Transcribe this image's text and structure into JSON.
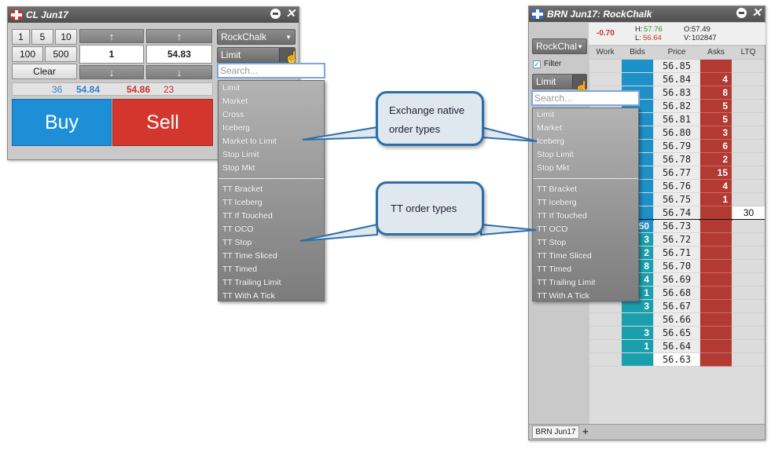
{
  "left_window": {
    "title": "CL Jun17",
    "qty_buttons": [
      "1",
      "5",
      "10",
      "100",
      "500"
    ],
    "clear_label": "Clear",
    "qty_value": "1",
    "price_value": "54.83",
    "account_dropdown": "RockChalk",
    "order_type_dropdown": "Limit",
    "market": {
      "bid_qty": "36",
      "bid_price": "54.84",
      "ask_price": "54.86",
      "ask_qty": "23"
    },
    "buy_label": "Buy",
    "sell_label": "Sell",
    "up_arrow": "↑",
    "down_arrow": "↓",
    "colors": {
      "buy": "#1e8fd6",
      "sell": "#d2362d",
      "bid_text": "#2a7fcf",
      "ask_text": "#c9302a"
    }
  },
  "left_menu": {
    "search_placeholder": "Search...",
    "exchange_items": [
      "Limit",
      "Market",
      "Cross",
      "Iceberg",
      "Market to Limit",
      "Stop Limit",
      "Stop Mkt"
    ],
    "tt_items": [
      "TT Bracket",
      "TT Iceberg",
      "TT If Touched",
      "TT OCO",
      "TT Stop",
      "TT Time Sliced",
      "TT Timed",
      "TT Trailing Limit",
      "TT With A Tick"
    ]
  },
  "callouts": {
    "exchange": "Exchange native order types",
    "tt": "TT order types"
  },
  "right_window": {
    "title": "BRN Jun17: RockChalk",
    "change": "-0.70",
    "high_label": "H:",
    "high": "57.76",
    "low_label": "L:",
    "low": "56.64",
    "open_label": "O:",
    "open": "57.49",
    "volume_label": "V:",
    "volume": "102847",
    "account_dropdown": "RockChal",
    "filter_label": "Filter",
    "order_type_dropdown": "Limit",
    "columns": [
      "Work",
      "Bids",
      "Price",
      "Asks",
      "LTQ"
    ],
    "tab_label": "BRN Jun17",
    "add_tab": "+",
    "ladder": [
      {
        "price": "56.85",
        "bid": "",
        "ask": ""
      },
      {
        "price": "56.84",
        "bid": "",
        "ask": "4"
      },
      {
        "price": "56.83",
        "bid": "",
        "ask": "8"
      },
      {
        "price": "56.82",
        "bid": "",
        "ask": "5"
      },
      {
        "price": "56.81",
        "bid": "",
        "ask": "5"
      },
      {
        "price": "56.80",
        "bid": "",
        "ask": "3"
      },
      {
        "price": "56.79",
        "bid": "",
        "ask": "6"
      },
      {
        "price": "56.78",
        "bid": "",
        "ask": "2"
      },
      {
        "price": "56.77",
        "bid": "",
        "ask": "15"
      },
      {
        "price": "56.76",
        "bid": "",
        "ask": "4"
      },
      {
        "price": "56.75",
        "bid": "",
        "ask": "1"
      },
      {
        "price": "56.74",
        "bid": "",
        "ask": "",
        "ltq": "30"
      },
      {
        "price": "56.73",
        "bid": "50",
        "ask": ""
      },
      {
        "price": "56.72",
        "bid": "3",
        "ask": ""
      },
      {
        "price": "56.71",
        "bid": "2",
        "ask": ""
      },
      {
        "price": "56.70",
        "bid": "8",
        "ask": ""
      },
      {
        "price": "56.69",
        "bid": "4",
        "ask": ""
      },
      {
        "price": "56.68",
        "bid": "1",
        "ask": ""
      },
      {
        "price": "56.67",
        "bid": "3",
        "ask": ""
      },
      {
        "price": "56.66",
        "bid": "",
        "ask": ""
      },
      {
        "price": "56.65",
        "bid": "3",
        "ask": ""
      },
      {
        "price": "56.64",
        "bid": "1",
        "ask": ""
      },
      {
        "price": "56.63",
        "bid": "",
        "ask": ""
      }
    ]
  },
  "right_menu": {
    "search_placeholder": "Search...",
    "exchange_items": [
      "Limit",
      "Market",
      "Iceberg",
      "Stop Limit",
      "Stop Mkt"
    ],
    "tt_items": [
      "TT Bracket",
      "TT Iceberg",
      "TT If Touched",
      "TT OCO",
      "TT Stop",
      "TT Time Sliced",
      "TT Timed",
      "TT Trailing Limit",
      "TT With A Tick"
    ]
  }
}
